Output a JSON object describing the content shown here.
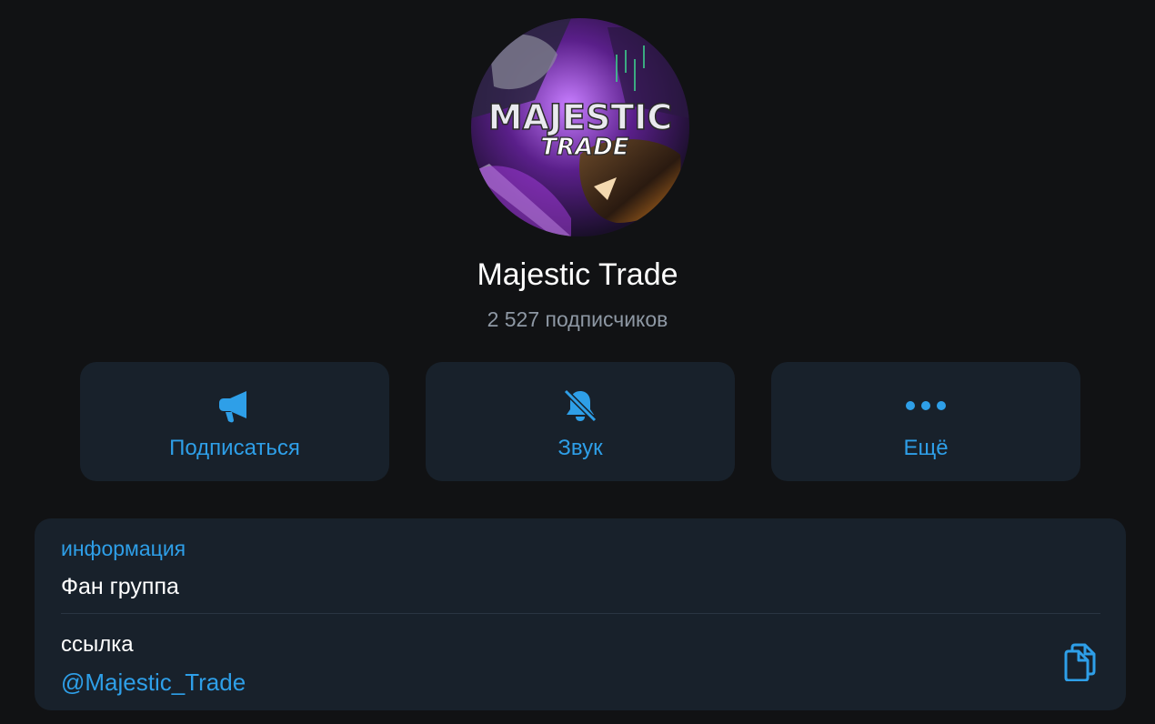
{
  "channel": {
    "name": "Majestic Trade",
    "subscribers": "2 527 подписчиков",
    "avatar_logo_line1": "MAJESTIC",
    "avatar_logo_line2": "TRADE"
  },
  "actions": [
    {
      "label": "Подписаться",
      "icon": "megaphone-icon"
    },
    {
      "label": "Звук",
      "icon": "bell-off-icon"
    },
    {
      "label": "Ещё",
      "icon": "more-dots-icon"
    }
  ],
  "info": {
    "caption": "информация",
    "value": "Фан группа"
  },
  "link": {
    "caption": "ссылка",
    "value": "@Majestic_Trade",
    "copy_icon": "copy-icon"
  },
  "colors": {
    "background": "#111214",
    "card": "#18212b",
    "accent": "#2e9fe8",
    "secondary_text": "#8e98a4"
  }
}
